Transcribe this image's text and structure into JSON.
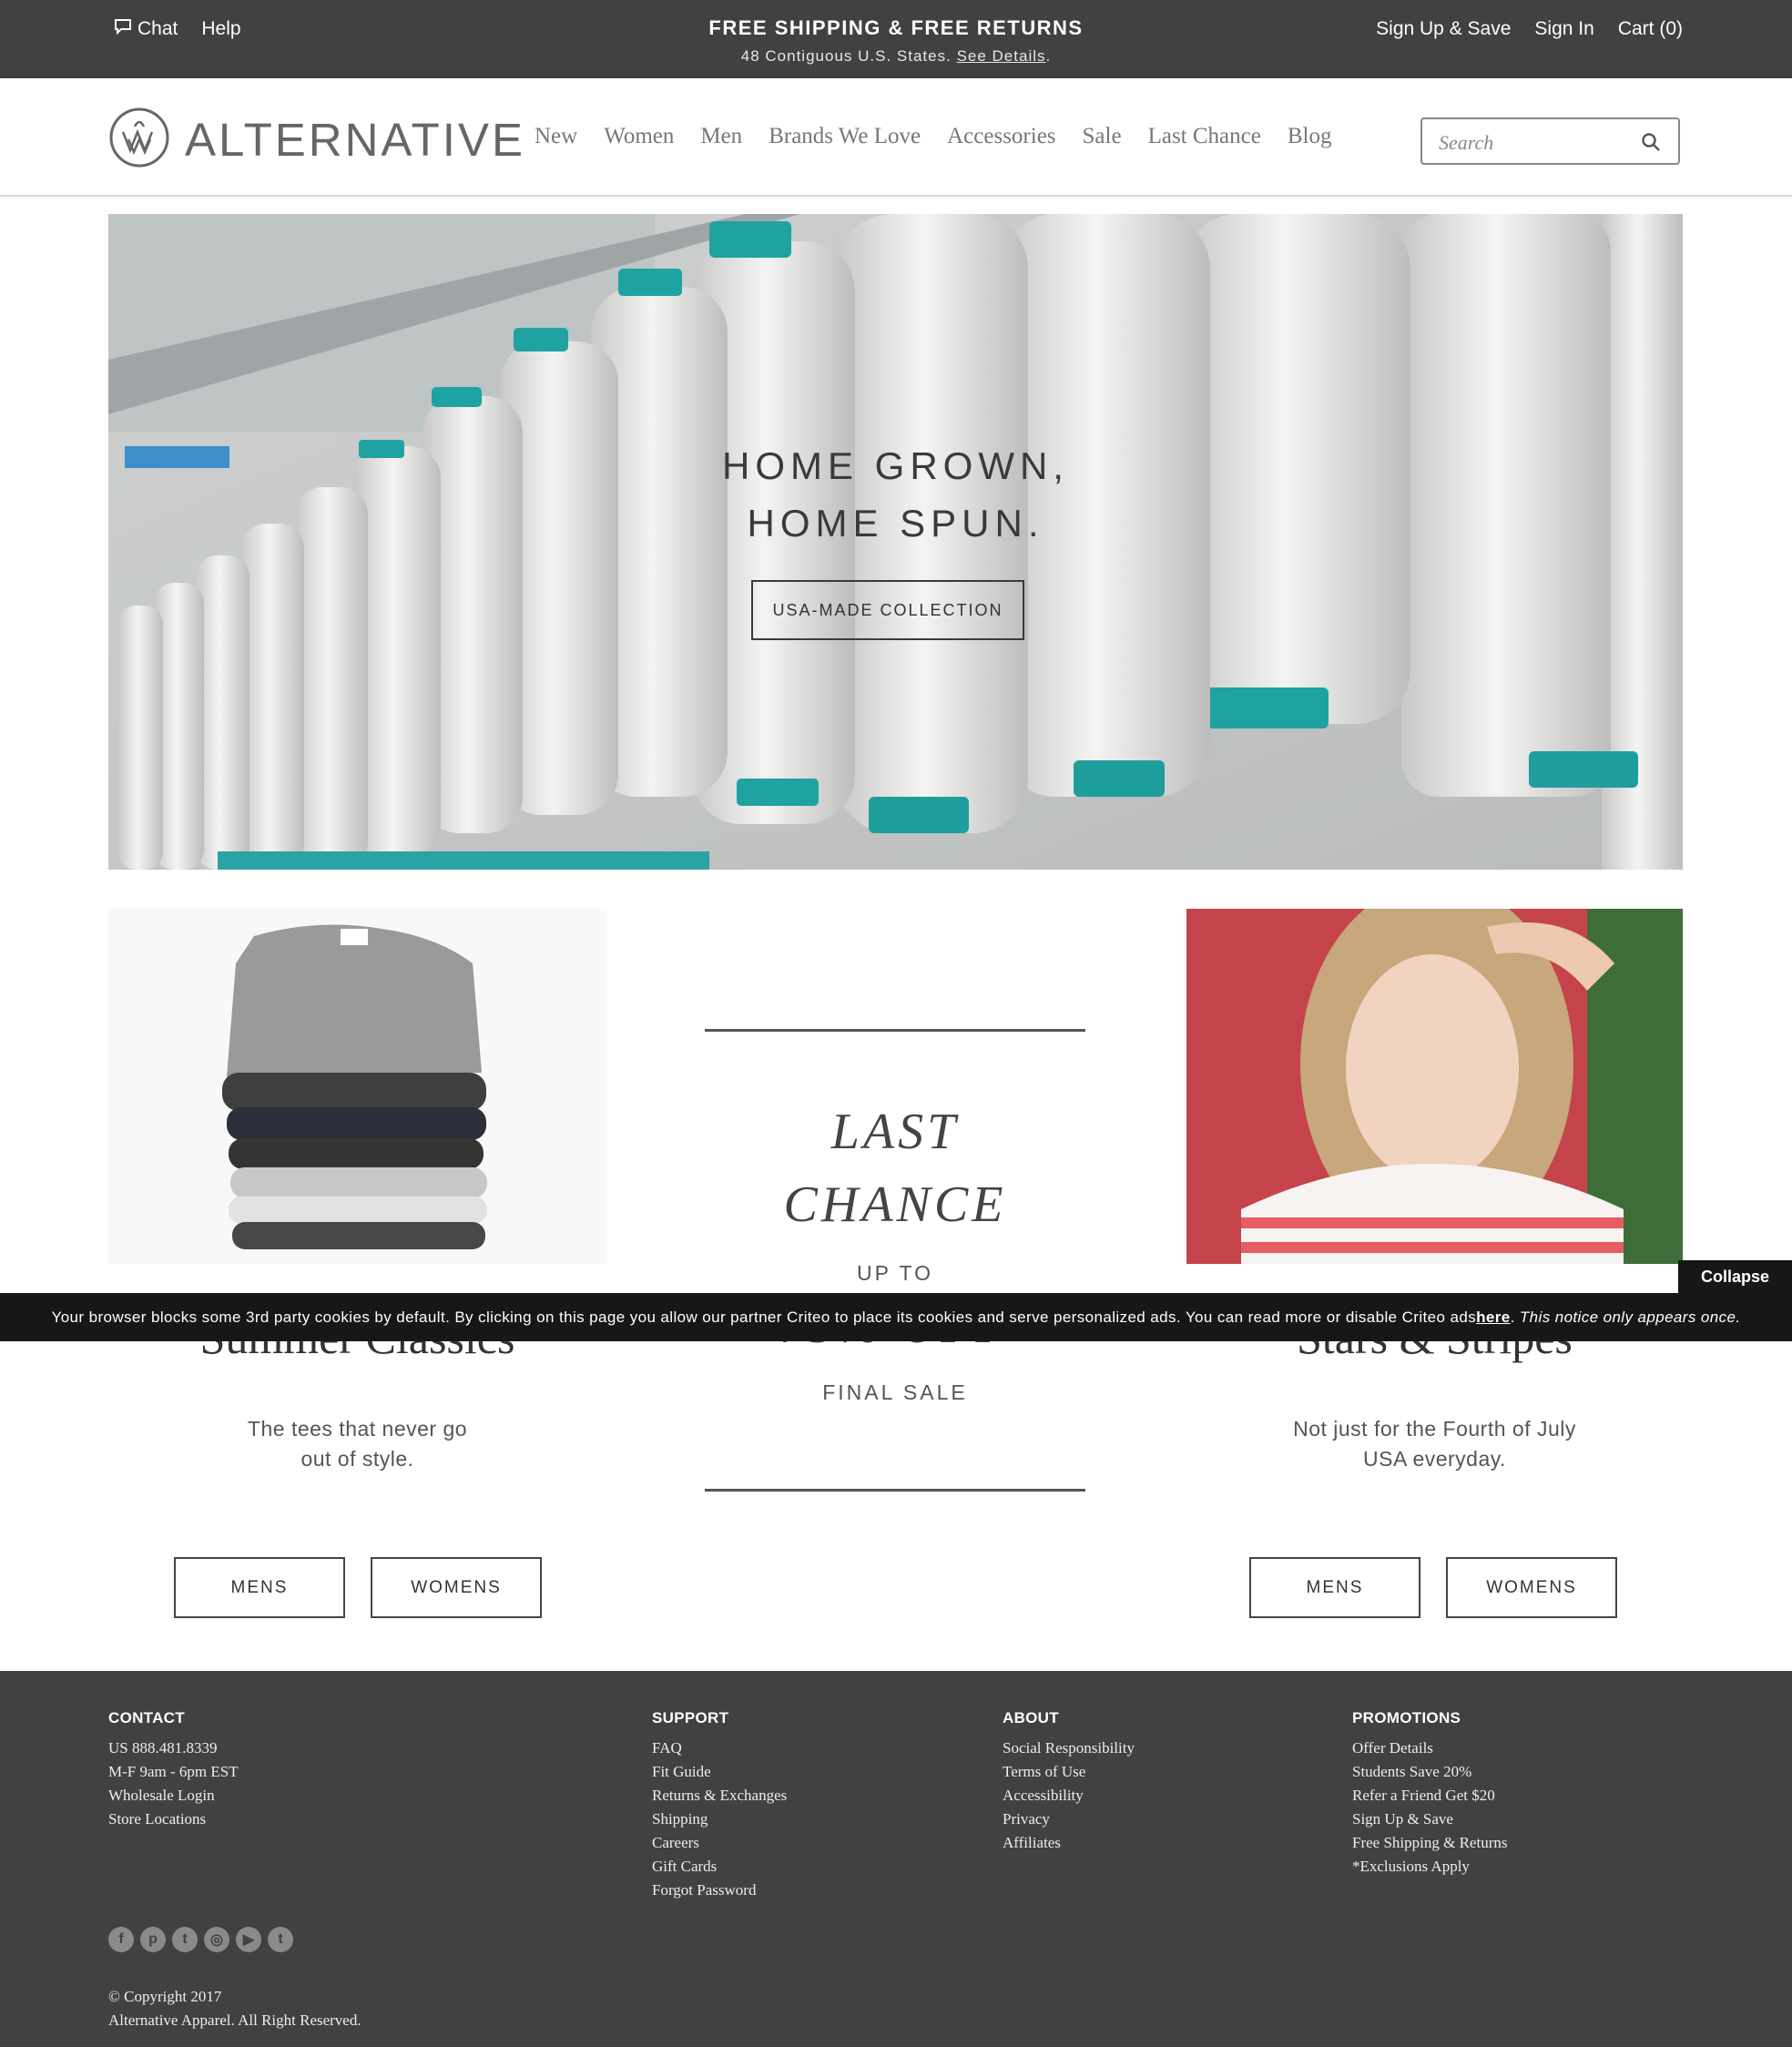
{
  "topbar": {
    "chat": "Chat",
    "help": "Help",
    "promo_title": "FREE SHIPPING & FREE RETURNS",
    "promo_sub": "48 Contiguous U.S. States.",
    "promo_link": "See Details",
    "promo_period": ".",
    "signup": "Sign Up & Save",
    "signin": "Sign In",
    "cart": "Cart (0)"
  },
  "header": {
    "logo": "ALTERNATIVE",
    "nav": [
      "New",
      "Women",
      "Men",
      "Brands We Love",
      "Accessories",
      "Sale",
      "Last Chance",
      "Blog"
    ],
    "search_placeholder": "Search"
  },
  "hero": {
    "line1": "HOME GROWN,",
    "line2": "HOME SPUN.",
    "button": "USA-MADE COLLECTION"
  },
  "promos": {
    "left": {
      "title": "Summer Classics",
      "desc1": "The tees that never go",
      "desc2": "out of style.",
      "btn_mens": "MENS",
      "btn_womens": "WOMENS"
    },
    "center": {
      "line1": "LAST",
      "line2": "CHANCE",
      "upto": "UP TO",
      "off": "75% OFF",
      "final": "FINAL SALE"
    },
    "right": {
      "title": "Stars & Stripes",
      "desc1": "Not just for the Fourth of July",
      "desc2": "USA everyday.",
      "btn_mens": "MENS",
      "btn_womens": "WOMENS"
    }
  },
  "cookie": {
    "text": "Your browser blocks some 3rd party cookies by default. By clicking on this page you allow our partner Criteo to place its cookies and serve personalized ads. You can read more or disable Criteo ads ",
    "link": "here",
    "tail": "This notice only appears once.",
    "collapse": "Collapse"
  },
  "footer": {
    "contact": {
      "heading": "CONTACT",
      "items": [
        "US 888.481.8339",
        "M-F 9am - 6pm EST",
        "Wholesale Login",
        "Store Locations"
      ]
    },
    "support": {
      "heading": "SUPPORT",
      "items": [
        "FAQ",
        "Fit Guide",
        "Returns & Exchanges",
        "Shipping",
        "Careers",
        "Gift Cards",
        "Forgot Password"
      ]
    },
    "about": {
      "heading": "ABOUT",
      "items": [
        "Social Responsibility",
        "Terms of Use",
        "Accessibility",
        "Privacy",
        "Affiliates"
      ]
    },
    "promotions": {
      "heading": "PROMOTIONS",
      "items": [
        "Offer Details",
        "Students Save 20%",
        "Refer a Friend Get $20",
        "Sign Up & Save",
        "Free Shipping & Returns",
        "*Exclusions Apply"
      ]
    },
    "social": [
      {
        "icon": "facebook-icon",
        "glyph": "f"
      },
      {
        "icon": "pinterest-icon",
        "glyph": "p"
      },
      {
        "icon": "twitter-icon",
        "glyph": "t"
      },
      {
        "icon": "instagram-icon",
        "glyph": "◎"
      },
      {
        "icon": "youtube-icon",
        "glyph": "▶"
      },
      {
        "icon": "tumblr-icon",
        "glyph": "t"
      }
    ],
    "copyright1": "© Copyright 2017",
    "copyright2": "Alternative Apparel. All Right Reserved."
  }
}
